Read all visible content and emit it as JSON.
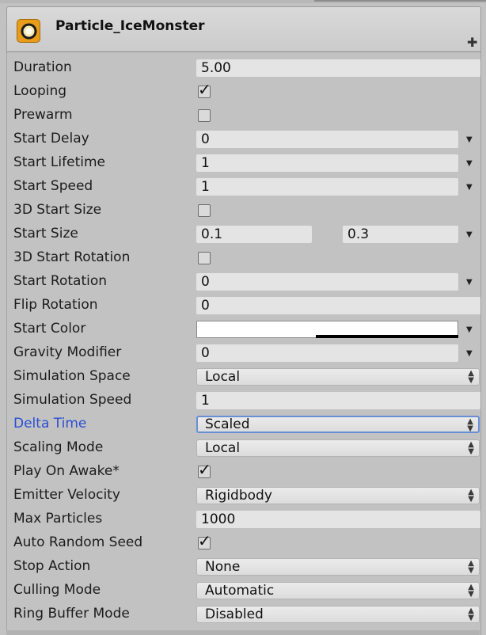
{
  "component": {
    "title": "Particle_IceMonster"
  },
  "properties": [
    {
      "label": "Duration",
      "value": "5.00",
      "type": "value"
    },
    {
      "label": "Looping",
      "checked": true,
      "type": "checkbox"
    },
    {
      "label": "Prewarm",
      "checked": false,
      "type": "checkbox"
    },
    {
      "label": "Start Delay",
      "value": "0",
      "type": "curve"
    },
    {
      "label": "Start Lifetime",
      "value": "1",
      "type": "curve"
    },
    {
      "label": "Start Speed",
      "value": "1",
      "type": "curve"
    },
    {
      "label": "3D Start Size",
      "checked": false,
      "type": "checkbox"
    },
    {
      "label": "Start Size",
      "min": "0.1",
      "max": "0.3",
      "type": "range"
    },
    {
      "label": "3D Start Rotation",
      "checked": false,
      "type": "checkbox"
    },
    {
      "label": "Start Rotation",
      "value": "0",
      "type": "curve"
    },
    {
      "label": "Flip Rotation",
      "value": "0",
      "type": "value"
    },
    {
      "label": "Start Color",
      "color": "#ffffff",
      "type": "color"
    },
    {
      "label": "Gravity Modifier",
      "value": "0",
      "type": "curve"
    },
    {
      "label": "Simulation Space",
      "value": "Local",
      "type": "dropdown"
    },
    {
      "label": "Simulation Speed",
      "value": "1",
      "type": "value"
    },
    {
      "label": "Delta Time",
      "value": "Scaled",
      "type": "dropdown",
      "focused": true
    },
    {
      "label": "Scaling Mode",
      "value": "Local",
      "type": "dropdown"
    },
    {
      "label": "Play On Awake*",
      "checked": true,
      "type": "checkbox"
    },
    {
      "label": "Emitter Velocity",
      "value": "Rigidbody",
      "type": "dropdown"
    },
    {
      "label": "Max Particles",
      "value": "1000",
      "type": "value"
    },
    {
      "label": "Auto Random Seed",
      "checked": true,
      "type": "checkbox"
    },
    {
      "label": "Stop Action",
      "value": "None",
      "type": "dropdown"
    },
    {
      "label": "Culling Mode",
      "value": "Automatic",
      "type": "dropdown"
    },
    {
      "label": "Ring Buffer Mode",
      "value": "Disabled",
      "type": "dropdown"
    }
  ],
  "icons": {
    "component": "particle-system-icon",
    "add": "plus-icon",
    "curve_menu": "dropdown-arrow-icon",
    "dropdown": "updown-arrows-icon"
  },
  "colors": {
    "focus_label": "#2b4fd1",
    "focus_border": "#6a8ed6"
  }
}
